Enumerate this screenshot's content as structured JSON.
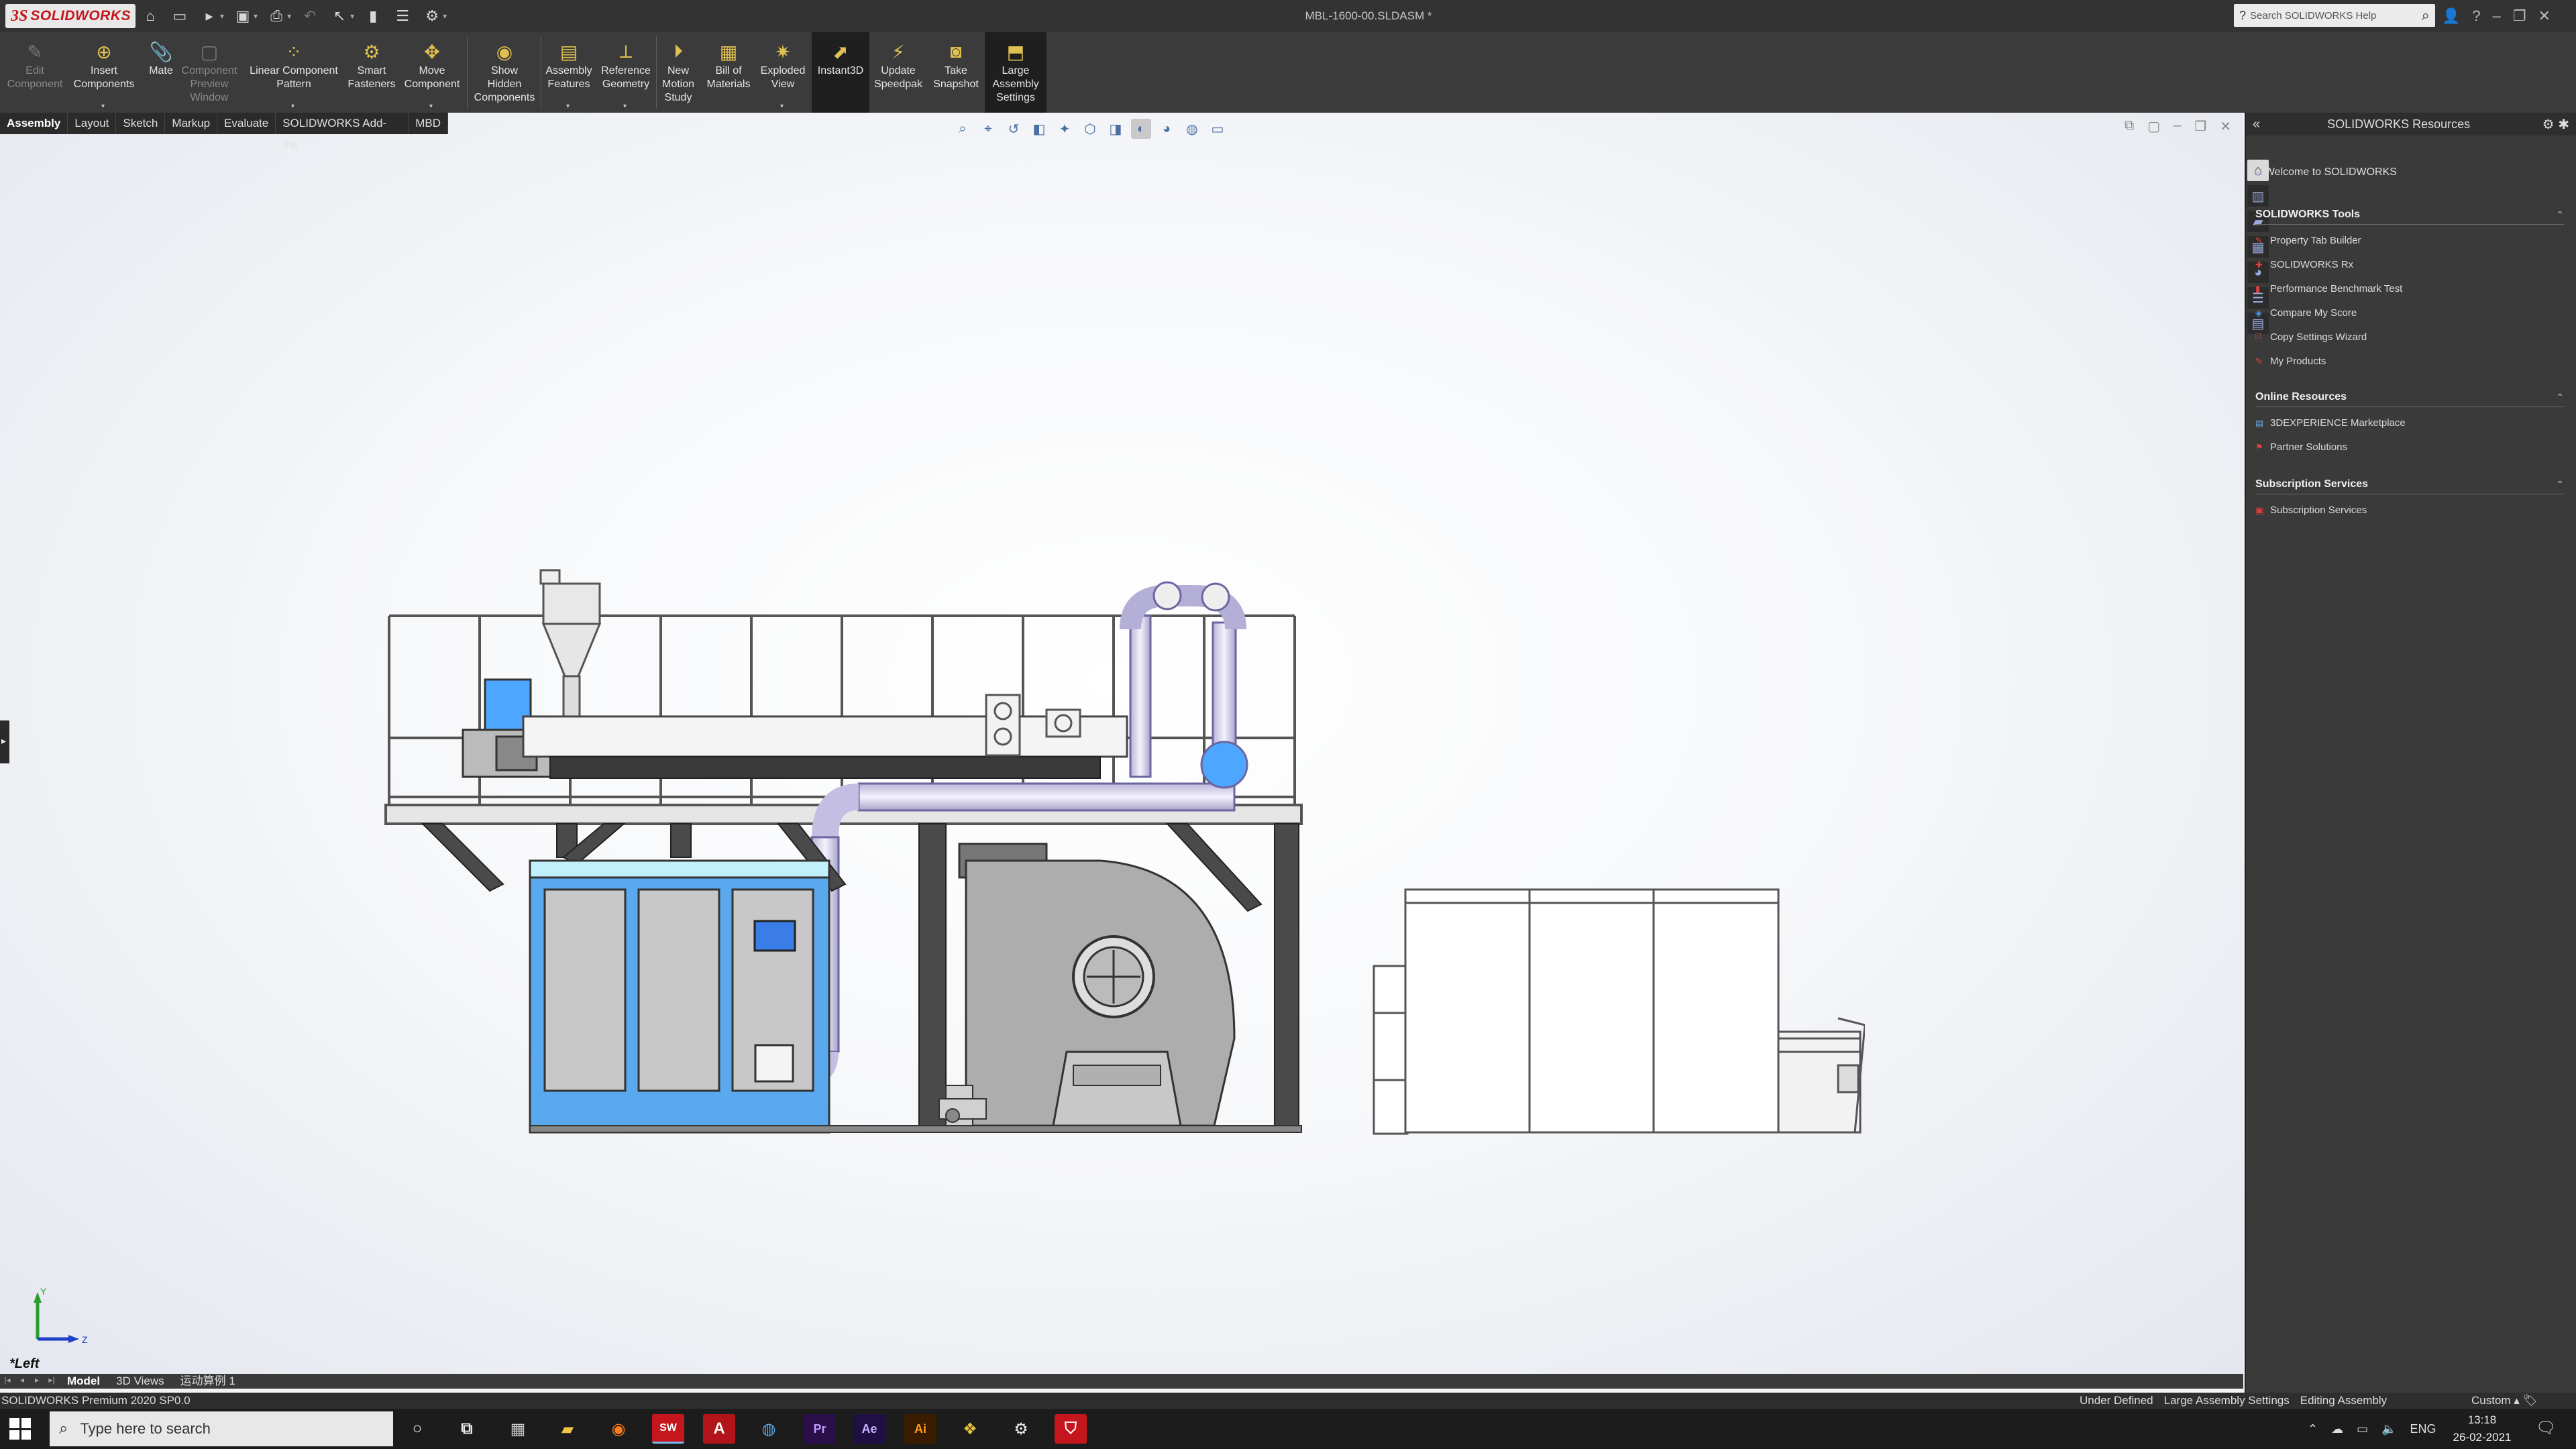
{
  "app": {
    "logo_ds": "3S",
    "logo_name": "SOLIDWORKS",
    "document_title": "MBL-1600-00.SLDASM *",
    "help_search_placeholder": "Search SOLIDWORKS Help"
  },
  "commands": [
    {
      "label": "Edit\nComponent",
      "icon": "edit-component-icon",
      "enabled": false
    },
    {
      "label": "Insert\nComponents",
      "icon": "insert-components-icon",
      "enabled": true
    },
    {
      "label": "Mate",
      "icon": "mate-icon",
      "enabled": true
    },
    {
      "label": "Component\nPreview\nWindow",
      "icon": "component-preview-icon",
      "enabled": false
    },
    {
      "label": "Linear Component\nPattern",
      "icon": "linear-pattern-icon",
      "enabled": true
    },
    {
      "label": "Smart\nFasteners",
      "icon": "smart-fasteners-icon",
      "enabled": true
    },
    {
      "label": "Move\nComponent",
      "icon": "move-component-icon",
      "enabled": true
    },
    {
      "label": "Show\nHidden\nComponents",
      "icon": "show-hidden-icon",
      "enabled": true
    },
    {
      "label": "Assembly\nFeatures",
      "icon": "assembly-features-icon",
      "enabled": true
    },
    {
      "label": "Reference\nGeometry",
      "icon": "reference-geometry-icon",
      "enabled": true
    },
    {
      "label": "New\nMotion\nStudy",
      "icon": "motion-study-icon",
      "enabled": true
    },
    {
      "label": "Bill of\nMaterials",
      "icon": "bill-of-materials-icon",
      "enabled": true
    },
    {
      "label": "Exploded\nView",
      "icon": "exploded-view-icon",
      "enabled": true
    },
    {
      "label": "Instant3D",
      "icon": "instant3d-icon",
      "enabled": true,
      "active": true
    },
    {
      "label": "Update\nSpeedpak",
      "icon": "speedpak-icon",
      "enabled": true
    },
    {
      "label": "Take\nSnapshot",
      "icon": "snapshot-icon",
      "enabled": true
    },
    {
      "label": "Large\nAssembly\nSettings",
      "icon": "large-assembly-icon",
      "enabled": true,
      "active": true
    }
  ],
  "tabs": [
    "Assembly",
    "Layout",
    "Sketch",
    "Markup",
    "Evaluate",
    "SOLIDWORKS Add-Ins",
    "MBD"
  ],
  "active_tab": "Assembly",
  "viewport": {
    "view_name": "*Left",
    "triad_y": "Y",
    "triad_z": "Z"
  },
  "task_pane": {
    "title": "SOLIDWORKS Resources",
    "welcome": "Welcome to SOLIDWORKS",
    "sections": [
      {
        "title": "SOLIDWORKS Tools",
        "items": [
          "Property Tab Builder",
          "SOLIDWORKS Rx",
          "Performance Benchmark Test",
          "Compare My Score",
          "Copy Settings Wizard",
          "My Products"
        ]
      },
      {
        "title": "Online Resources",
        "items": [
          "3DEXPERIENCE Marketplace",
          "Partner Solutions"
        ]
      },
      {
        "title": "Subscription Services",
        "items": [
          "Subscription Services"
        ]
      }
    ]
  },
  "bottom_tabs": [
    "Model",
    "3D Views",
    "运动算例 1"
  ],
  "active_bottom_tab": "Model",
  "status": {
    "product": "SOLIDWORKS Premium 2020 SP0.0",
    "state": "Under Defined",
    "mode1": "Large Assembly Settings",
    "mode2": "Editing Assembly",
    "units": "Custom"
  },
  "taskbar": {
    "search_placeholder": "Type here to search",
    "language": "ENG",
    "time": "13:18",
    "date": "26-02-2021"
  },
  "colors": {
    "accent_blue": "#4da6ff",
    "cabinet_blue": "#5aa8ee",
    "pipe_lavender": "#dcd8f0",
    "solidworks_red": "#c4161c"
  }
}
